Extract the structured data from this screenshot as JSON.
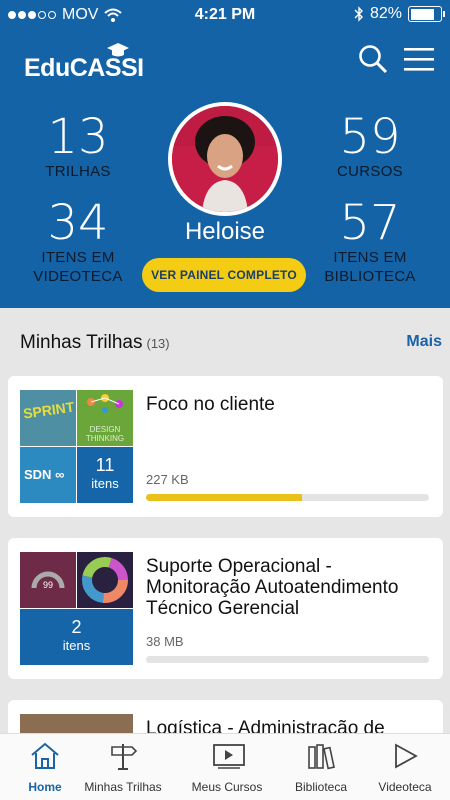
{
  "status_bar": {
    "carrier": "MOV",
    "time": "4:21 PM",
    "battery": "82%",
    "battery_level": 0.82
  },
  "header": {
    "logo": "EduCASSI",
    "search_icon": "search-icon",
    "menu_icon": "hamburger-menu-icon"
  },
  "profile": {
    "name": "Heloise",
    "button": "VER PAINEL COMPLETO",
    "stats": {
      "trilhas": {
        "value": "13",
        "label": "TRILHAS"
      },
      "cursos": {
        "value": "59",
        "label": "CURSOS"
      },
      "videoteca": {
        "value": "34",
        "label_1": "ITENS EM",
        "label_2": "VIDEOTECA"
      },
      "biblioteca": {
        "value": "57",
        "label_1": "ITENS EM",
        "label_2": "BIBLIOTECA"
      }
    }
  },
  "section": {
    "title": "Minhas Trilhas",
    "count": "(13)",
    "more": "Mais"
  },
  "cards": [
    {
      "title": "Foco no cliente",
      "size": "227 KB",
      "progress": 0.55,
      "items_count": "11",
      "items_label": "itens",
      "thumb_text_1": "SPRINT",
      "thumb_text_2": "DESIGN THINKING",
      "thumb_text_3": "SDN"
    },
    {
      "title_1": "Suporte Operacional -",
      "title_2": "Monitoração Autoatendimento",
      "title_3": "Técnico Gerencial",
      "size": "38 MB",
      "progress": 0.0,
      "items_count": "2",
      "items_label": "itens",
      "thumb_text_1": "99"
    },
    {
      "title": "Logística - Administração de"
    }
  ],
  "tabs": [
    {
      "label": "Home",
      "icon": "home-icon",
      "active": true
    },
    {
      "label": "Minhas Trilhas",
      "icon": "signpost-icon"
    },
    {
      "label": "Meus Cursos",
      "icon": "video-player-icon"
    },
    {
      "label": "Biblioteca",
      "icon": "books-icon"
    },
    {
      "label": "Videoteca",
      "icon": "play-icon"
    }
  ],
  "colors": {
    "primary": "#1463a6",
    "accent": "#f5cc14",
    "progress": "#eac11a"
  }
}
